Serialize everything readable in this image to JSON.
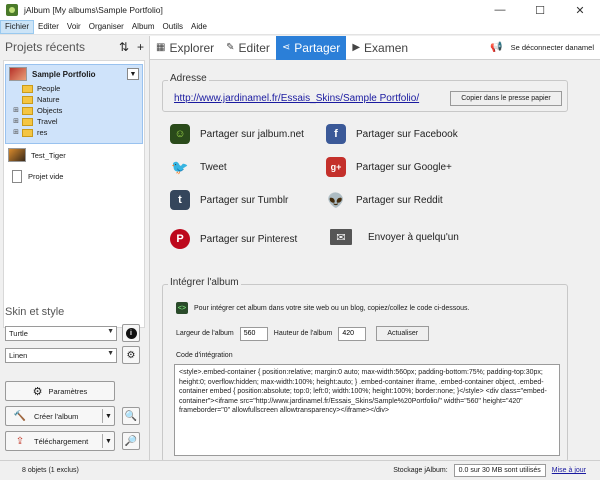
{
  "window": {
    "title": "jAlbum [My albums\\Sample Portfolio]"
  },
  "menu": [
    "Fichier",
    "Editer",
    "Voir",
    "Organiser",
    "Album",
    "Outils",
    "Aide"
  ],
  "left": {
    "heading": "Projets récents",
    "selected_project": "Sample Portfolio",
    "folders": [
      "People",
      "Nature",
      "Objects",
      "Travel",
      "res"
    ],
    "other_projects": [
      "Test_Tiger",
      "Projet vide"
    ],
    "skin_heading": "Skin et style",
    "skin_value": "Turtle",
    "style_value": "Linen",
    "buttons": {
      "settings": "Paramètres",
      "create_album": "Créer l'album",
      "upload": "Téléchargement"
    }
  },
  "tabs": {
    "explore": "Explorer",
    "edit": "Editer",
    "share": "Partager",
    "review": "Examen",
    "disconnect": "Se déconnecter danamel"
  },
  "address": {
    "label": "Adresse",
    "url": "http://www.jardinamel.fr/Essais_Skins/Sample Portfolio/",
    "copy_button": "Copier dans le presse papier"
  },
  "share_options": {
    "jalbum": "Partager sur jalbum.net",
    "facebook": "Partager sur Facebook",
    "tweet": "Tweet",
    "google": "Partager sur Google+",
    "tumblr": "Partager sur Tumblr",
    "reddit": "Partager sur Reddit",
    "pinterest": "Partager sur Pinterest",
    "email": "Envoyer à quelqu'un"
  },
  "embed": {
    "label": "Intégrer l'album",
    "note": "Pour intégrer cet album dans votre site web ou un blog, copiez/collez le code ci-dessous.",
    "width_label": "Largeur de l'album",
    "width_value": "560",
    "height_label": "Hauteur de l'album",
    "height_value": "420",
    "update_button": "Actualiser",
    "code_label": "Code d'intégration",
    "code_text": "<style>.embed-container { position:relative; margin:0 auto; max-width:560px; padding-bottom:75%; padding-top:30px; height:0; overflow:hidden; max-width:100%; height:auto; } .embed-container iframe, .embed-container object, .embed-container embed { position:absolute; top:0; left:0; width:100%; height:100%; border:none; }</style>\n<div class=\"embed-container\"><iframe src=\"http://www.jardinamel.fr/Essais_Skins/Sample%20Portfolio/\" width=\"560\" height=\"420\" frameborder=\"0\" allowfullscreen allowtransparency></iframe></div>"
  },
  "status": {
    "objects": "8 objets (1 exclus)",
    "storage_label": "Stockage jAlbum:",
    "storage_value": "0.0 sur 30 MB sont utilisés",
    "update_link": "Mise à jour"
  }
}
